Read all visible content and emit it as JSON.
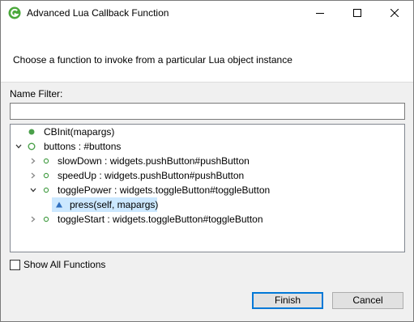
{
  "window": {
    "title": "Advanced Lua Callback Function",
    "controls": {
      "minimize": "minimize",
      "maximize": "maximize",
      "close": "close"
    }
  },
  "header": {
    "description": "Choose a function to invoke from a particular Lua object instance"
  },
  "filter": {
    "label": "Name Filter:",
    "value": "",
    "placeholder": ""
  },
  "tree": {
    "items": [
      {
        "label": "CBInit(mapargs)",
        "icon": "green-dot-icon",
        "twisty": "none"
      },
      {
        "label": "buttons : #buttons",
        "icon": "green-circle-icon",
        "twisty": "expanded"
      },
      {
        "label": "slowDown : widgets.pushButton#pushButton",
        "icon": "small-green-dot-icon",
        "twisty": "collapsed"
      },
      {
        "label": "speedUp : widgets.pushButton#pushButton",
        "icon": "small-green-dot-icon",
        "twisty": "collapsed"
      },
      {
        "label": "togglePower : widgets.toggleButton#toggleButton",
        "icon": "small-green-dot-icon",
        "twisty": "expanded"
      },
      {
        "label": "press(self, mapargs)",
        "icon": "blue-triangle-icon",
        "twisty": "none",
        "selected": true
      },
      {
        "label": "toggleStart : widgets.toggleButton#toggleButton",
        "icon": "small-green-dot-icon",
        "twisty": "collapsed"
      }
    ]
  },
  "options": {
    "show_all_label": "Show All Functions",
    "show_all_checked": false
  },
  "buttons": {
    "finish": "Finish",
    "cancel": "Cancel"
  },
  "colors": {
    "accent": "#0078d7",
    "selection": "#cce8ff",
    "node_green": "#4aa04a",
    "method_blue": "#2f6fbf"
  }
}
